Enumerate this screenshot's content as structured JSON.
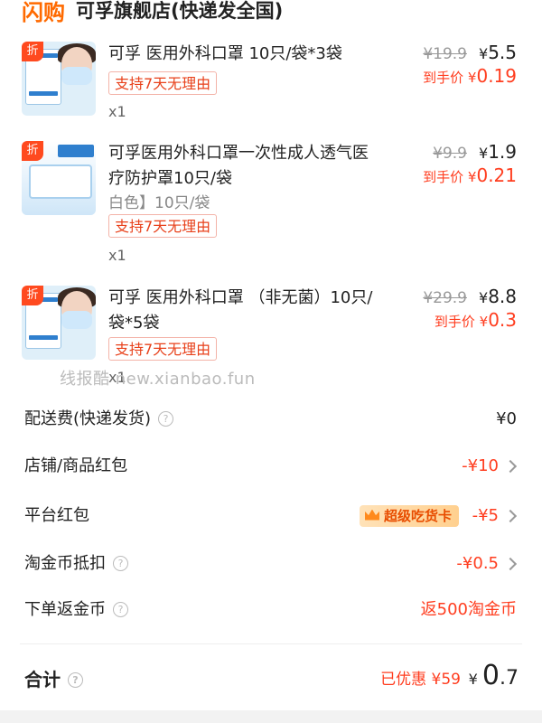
{
  "store": {
    "logo_text": "闪购",
    "name": "可孚旗舰店(快递发全国)"
  },
  "items": [
    {
      "title": "可孚 医用外科口罩 10只/袋*3袋",
      "variant": "",
      "support": "支持7天无理由",
      "qty": "x1",
      "orig_price": "¥19.9",
      "price_symbol": "¥",
      "price": "5.5",
      "final_label": "到手价",
      "final_symbol": "¥",
      "final_price": "0.19",
      "discount_tag": "折"
    },
    {
      "title": "可孚医用外科口罩一次性成人透气医疗防护罩10只/袋",
      "variant": "白色】10只/袋",
      "support": "支持7天无理由",
      "qty": "x1",
      "orig_price": "¥9.9",
      "price_symbol": "¥",
      "price": "1.9",
      "final_label": "到手价",
      "final_symbol": "¥",
      "final_price": "0.21",
      "discount_tag": "折"
    },
    {
      "title": "可孚 医用外科口罩 （非无菌）10只/袋*5袋",
      "variant": "",
      "support": "支持7天无理由",
      "qty": "x1",
      "orig_price": "¥29.9",
      "price_symbol": "¥",
      "price": "8.8",
      "final_label": "到手价",
      "final_symbol": "¥",
      "final_price": "0.3",
      "discount_tag": "折"
    }
  ],
  "watermark": "线报酷 new.xianbao.fun",
  "summary": {
    "shipping": {
      "label": "配送费(快递发货)",
      "value": "¥0"
    },
    "store_coupon": {
      "label": "店铺/商品红包",
      "value": "-¥10"
    },
    "platform_coupon": {
      "label": "平台红包",
      "badge": "超级吃货卡",
      "value": "-¥5"
    },
    "coins_deduct": {
      "label": "淘金币抵扣",
      "value": "-¥0.5"
    },
    "coins_return": {
      "label": "下单返金币",
      "value": "返500淘金币"
    }
  },
  "total": {
    "label": "合计",
    "saved": "已优惠 ¥59",
    "symbol": "¥",
    "int": "0",
    "dec": ".7"
  },
  "icons": {
    "help": "?"
  },
  "colors": {
    "accent": "#ff3d1f",
    "brand": "#ff6a00"
  }
}
